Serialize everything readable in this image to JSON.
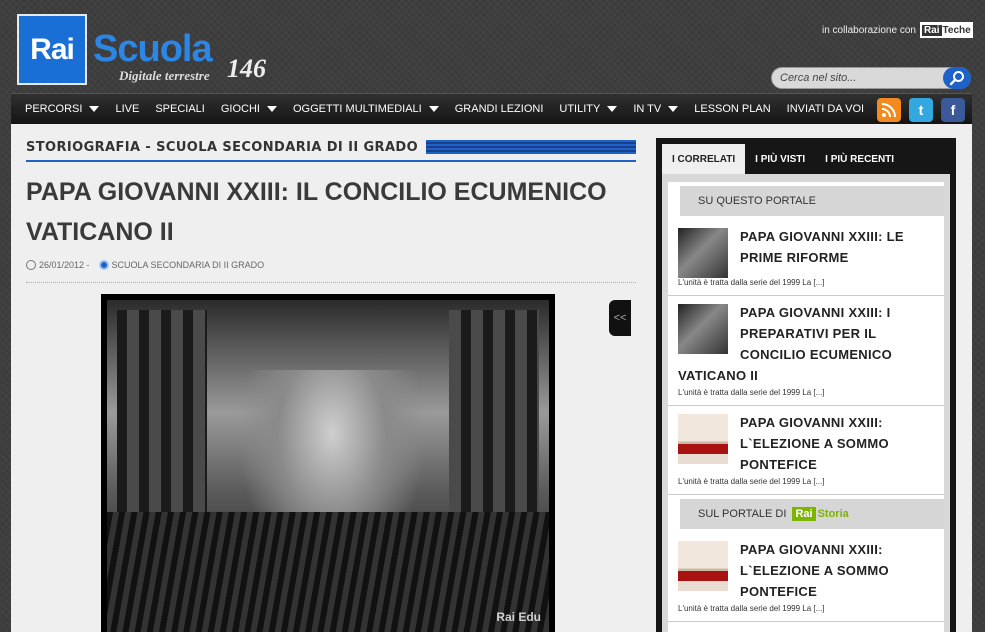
{
  "header": {
    "logo_rai": "Rai",
    "logo_scuola": "Scuola",
    "logo_tagline": "Digitale terrestre",
    "logo_channel": "146",
    "collab_text": "in collaborazione con",
    "collab_logo_rai": "Rai",
    "collab_logo_name": "Teche",
    "search_placeholder": "Cerca nel sito..."
  },
  "nav": {
    "items": [
      {
        "label": "PERCORSI",
        "dropdown": true
      },
      {
        "label": "LIVE",
        "dropdown": false
      },
      {
        "label": "SPECIALI",
        "dropdown": false
      },
      {
        "label": "GIOCHI",
        "dropdown": true
      },
      {
        "label": "OGGETTI MULTIMEDIALI",
        "dropdown": true
      },
      {
        "label": "GRANDI LEZIONI",
        "dropdown": false
      },
      {
        "label": "UTILITY",
        "dropdown": true
      },
      {
        "label": "IN TV",
        "dropdown": true
      },
      {
        "label": "LESSON PLAN",
        "dropdown": false
      },
      {
        "label": "INVIATI DA VOI",
        "dropdown": false
      }
    ],
    "social": [
      {
        "name": "rss-icon",
        "color": "#f28a1e"
      },
      {
        "name": "twitter-icon",
        "color": "#33a8e0"
      },
      {
        "name": "facebook-icon",
        "color": "#3b5998"
      }
    ]
  },
  "article": {
    "breadcrumb": "STORIOGRAFIA - SCUOLA SECONDARIA DI II GRADO",
    "title": "PAPA GIOVANNI XXIII: IL CONCILIO ECUMENICO VATICANO II",
    "date": "26/01/2012 -",
    "category": "SCUOLA SECONDARIA DI II GRADO",
    "video_watermark": "Rai Edu",
    "toggle_label": "<<"
  },
  "sidebar": {
    "tabs": [
      "I CORRELATI",
      "I PIÙ VISTI",
      "I PIÙ RECENTI"
    ],
    "active_tab": 0,
    "section1_title": "SU QUESTO PORTALE",
    "section2_title": "SUL PORTALE DI",
    "section2_logo_rai": "Rai",
    "section2_logo_name": "Storia",
    "items1": [
      {
        "title": "PAPA GIOVANNI XXIII: LE PRIME RIFORME",
        "desc": "L'unità è tratta dalla serie del 1999 La [...]",
        "thumb": "bw"
      },
      {
        "title": "PAPA GIOVANNI XXIII: I PREPARATIVI PER IL CONCILIO ECUMENICO VATICANO II",
        "desc": "L'unità è tratta dalla serie del 1999 La [...]",
        "thumb": "bw"
      },
      {
        "title": "PAPA GIOVANNI XXIII: L`ELEZIONE A SOMMO PONTEFICE",
        "desc": "L'unità è tratta dalla serie del 1999 La [...]",
        "thumb": "room"
      }
    ],
    "items2": [
      {
        "title": "PAPA GIOVANNI XXIII: L`ELEZIONE A SOMMO PONTEFICE",
        "desc": "L'unità è tratta dalla serie del 1999 La [...]",
        "thumb": "room"
      }
    ]
  }
}
